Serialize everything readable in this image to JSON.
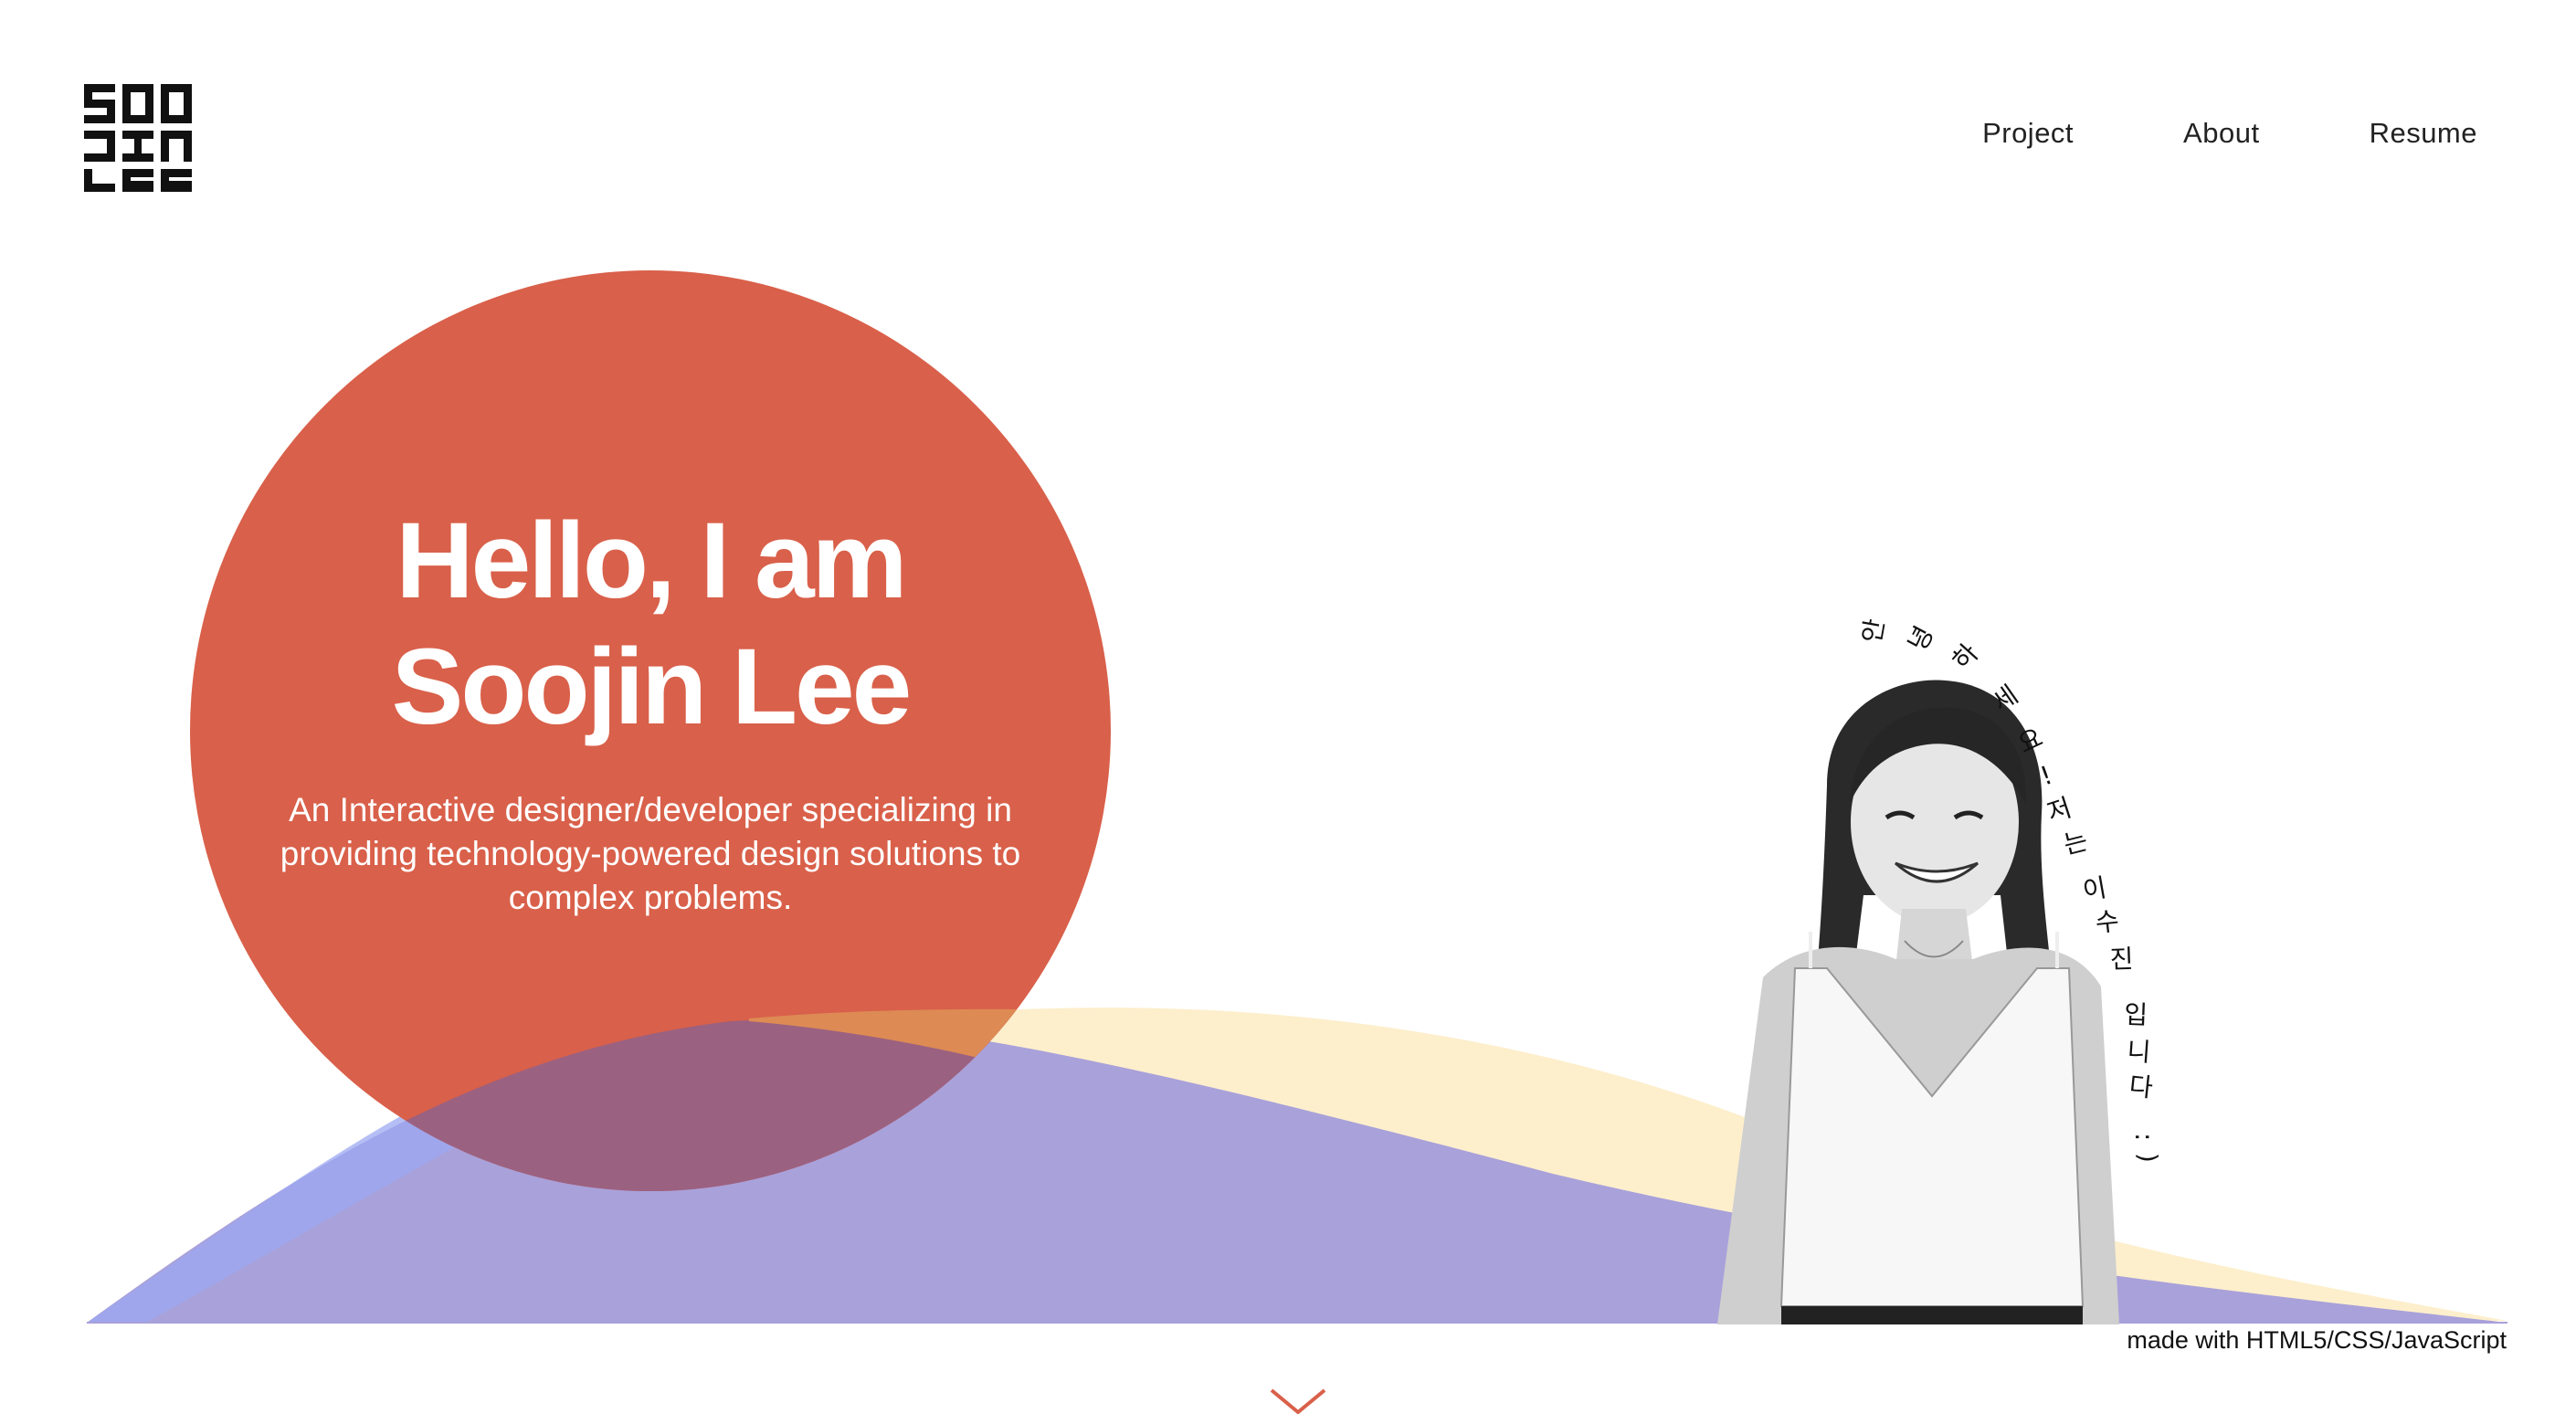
{
  "logo": {
    "text": "SOO JIN LEE"
  },
  "nav": {
    "items": [
      {
        "label": "Project"
      },
      {
        "label": "About"
      },
      {
        "label": "Resume"
      }
    ]
  },
  "hero": {
    "title_line1": "Hello, I am",
    "title_line2": "Soojin Lee",
    "subtitle": "An Interactive designer/developer specializing in providing technology-powered design solutions to complex problems."
  },
  "greeting": {
    "chars": [
      "안",
      "녕",
      "하",
      "세",
      "요",
      "!",
      "저",
      "는",
      "이",
      "수",
      "진",
      "입",
      "니",
      "다",
      ":",
      ")"
    ]
  },
  "footer": {
    "made_with": "made with HTML5/CSS/JavaScript"
  },
  "colors": {
    "circle": "#D9604A",
    "wave_purple": "#A89ED6",
    "wave_yellow": "#FDEFCC",
    "wave_blue": "#9CA8F2",
    "overlap": "#9B6180",
    "accent": "#D9604A"
  },
  "icons": {
    "logo": "soojin-lee-monogram",
    "scroll": "chevron-down-icon"
  }
}
